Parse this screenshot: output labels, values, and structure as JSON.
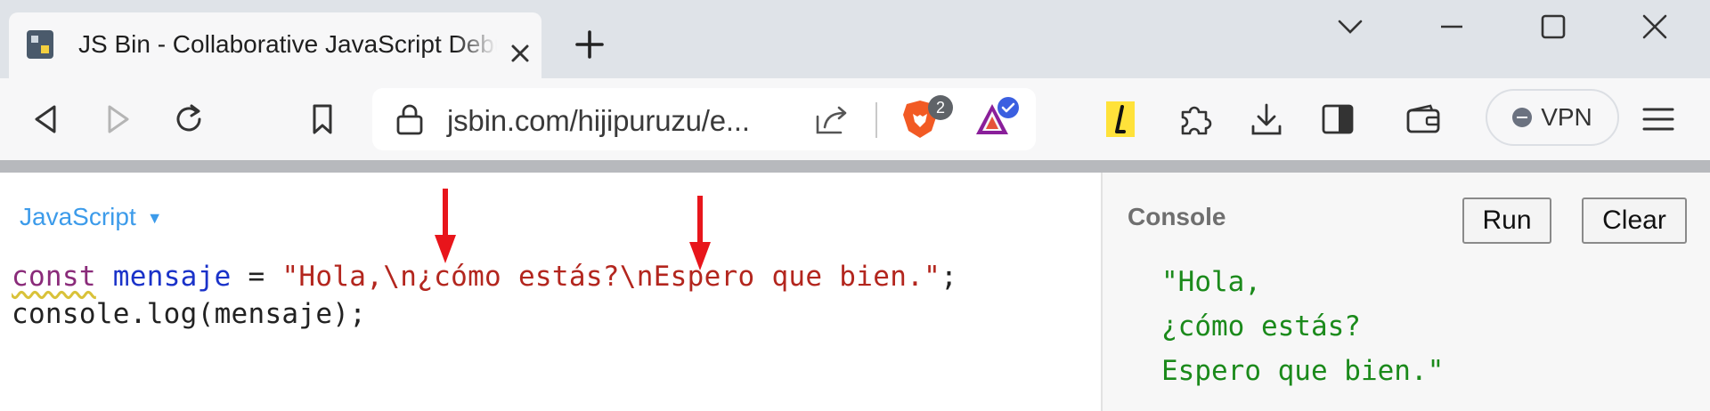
{
  "browser": {
    "tab": {
      "title": "JS Bin - Collaborative JavaScript Debugging",
      "favicon": "jsbin-favicon"
    },
    "address_bar": {
      "url": "jsbin.com/hijipuruzu/e..."
    },
    "extensions": {
      "brave_shields_count": "2"
    },
    "vpn_label": "VPN",
    "colors": {
      "tab_strip": "#dfe3e8",
      "toolbar": "#f7f7f8",
      "brave_orange": "#f25a24"
    }
  },
  "editor": {
    "language": "JavaScript",
    "code_line1": {
      "keyword": "const",
      "variable": "mensaje",
      "operator": " = ",
      "string_part1": "\"Hola,",
      "escape1": "\\n",
      "string_part2": "¿cómo estás?",
      "escape2": "\\n",
      "string_part3": "Espero que bien.\"",
      "terminator": ";"
    },
    "code_line2": "console.log(mensaje);",
    "annotation_color": "#e8151b"
  },
  "console": {
    "title": "Console",
    "run_label": "Run",
    "clear_label": "Clear",
    "output": [
      "\"Hola,",
      "¿cómo estás?",
      "Espero que bien.\""
    ],
    "output_color": "#1b8a1b"
  }
}
